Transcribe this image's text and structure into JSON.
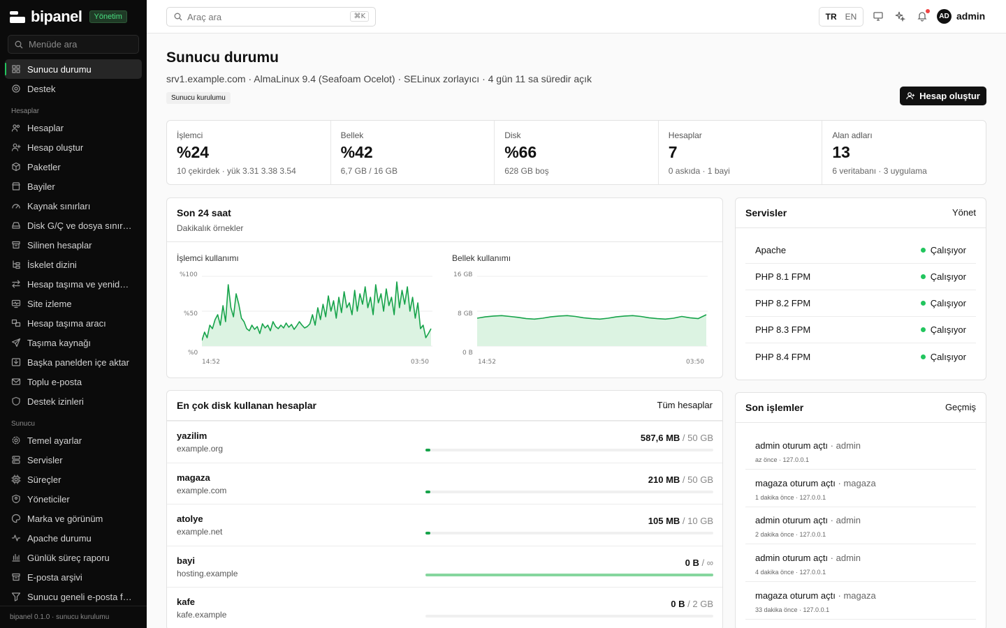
{
  "brand": {
    "name": "bipanel",
    "badge": "Yönetim"
  },
  "sidebar": {
    "search_placeholder": "Menüde ara",
    "top_items": [
      {
        "label": "Sunucu durumu",
        "icon": "dashboard-icon",
        "active": true
      },
      {
        "label": "Destek",
        "icon": "lifebuoy-icon"
      }
    ],
    "section_accounts": "Hesaplar",
    "account_items": [
      {
        "label": "Hesaplar",
        "icon": "users-icon"
      },
      {
        "label": "Hesap oluştur",
        "icon": "user-plus-icon"
      },
      {
        "label": "Paketler",
        "icon": "package-icon"
      },
      {
        "label": "Bayiler",
        "icon": "store-icon"
      },
      {
        "label": "Kaynak sınırları",
        "icon": "gauge-icon"
      },
      {
        "label": "Disk G/Ç ve dosya sınırları",
        "icon": "hard-drive-icon"
      },
      {
        "label": "Silinen hesaplar",
        "icon": "archive-icon"
      },
      {
        "label": "İskelet dizini",
        "icon": "folder-tree-icon"
      },
      {
        "label": "Hesap taşıma ve yeniden adlandırma",
        "icon": "arrows-swap-icon"
      },
      {
        "label": "Site izleme",
        "icon": "monitor-heart-icon"
      },
      {
        "label": "Hesap taşıma aracı",
        "icon": "transfer-icon"
      },
      {
        "label": "Taşıma kaynağı",
        "icon": "send-icon"
      },
      {
        "label": "Başka panelden içe aktar",
        "icon": "import-icon"
      },
      {
        "label": "Toplu e-posta",
        "icon": "mail-icon"
      },
      {
        "label": "Destek izinleri",
        "icon": "shield-icon"
      }
    ],
    "section_server": "Sunucu",
    "server_items": [
      {
        "label": "Temel ayarlar",
        "icon": "gear-icon"
      },
      {
        "label": "Servisler",
        "icon": "server-icon"
      },
      {
        "label": "Süreçler",
        "icon": "cpu-icon"
      },
      {
        "label": "Yöneticiler",
        "icon": "user-shield-icon"
      },
      {
        "label": "Marka ve görünüm",
        "icon": "palette-icon"
      },
      {
        "label": "Apache durumu",
        "icon": "activity-icon"
      },
      {
        "label": "Günlük süreç raporu",
        "icon": "bar-chart-icon"
      },
      {
        "label": "E-posta arşivi",
        "icon": "mail-archive-icon"
      },
      {
        "label": "Sunucu geneli e-posta filtreleri",
        "icon": "filter-icon"
      }
    ],
    "footer": "bipanel 0.1.0 · sunucu kurulumu"
  },
  "topbar": {
    "search_placeholder": "Araç ara",
    "shortcut": "⌘K",
    "lang_active": "TR",
    "lang_other": "EN",
    "avatar_initials": "AD",
    "user": "admin"
  },
  "page": {
    "title": "Sunucu durumu",
    "subtitle": "srv1.example.com · AlmaLinux 9.4 (Seafoam Ocelot) · SELinux zorlayıcı · 4 gün 11 sa süredir açık",
    "crumb": "Sunucu kurulumu",
    "primary_button": "Hesap oluştur"
  },
  "stats": [
    {
      "label": "İşlemci",
      "value": "%24",
      "note": "10 çekirdek · yük 3.31 3.38 3.54"
    },
    {
      "label": "Bellek",
      "value": "%42",
      "note": "6,7 GB / 16 GB"
    },
    {
      "label": "Disk",
      "value": "%66",
      "note": "628 GB boş"
    },
    {
      "label": "Hesaplar",
      "value": "7",
      "note": "0 askıda · 1 bayi"
    },
    {
      "label": "Alan adları",
      "value": "13",
      "note": "6 veritabanı · 3 uygulama"
    }
  ],
  "history": {
    "title": "Son 24 saat",
    "desc": "Dakikalık örnekler",
    "accent": "#16a34a",
    "cpu_label": "İşlemci kullanımı",
    "mem_label": "Bellek kullanımı"
  },
  "chart_data": [
    {
      "type": "area",
      "title": "İşlemci kullanımı",
      "x_start": "14:52",
      "x_end": "03:50",
      "y_ticks": [
        "%100",
        "%50",
        "%0"
      ],
      "ylim": [
        0,
        100
      ],
      "grid": true,
      "series": [
        {
          "values": [
            8,
            20,
            12,
            30,
            25,
            38,
            45,
            30,
            58,
            35,
            88,
            55,
            42,
            75,
            60,
            40,
            35,
            25,
            22,
            30,
            24,
            28,
            18,
            32,
            26,
            30,
            22,
            35,
            28,
            25,
            30,
            26,
            33,
            27,
            31,
            24,
            29,
            35,
            30,
            26,
            28,
            32,
            45,
            30,
            55,
            38,
            60,
            42,
            72,
            50,
            65,
            40,
            70,
            48,
            78,
            55,
            62,
            45,
            80,
            50,
            75,
            60,
            85,
            55,
            70,
            45,
            88,
            62,
            75,
            50,
            82,
            58,
            70,
            45,
            92,
            55,
            80,
            60,
            85,
            50,
            70,
            40,
            62,
            25,
            30,
            12,
            18,
            25
          ]
        }
      ]
    },
    {
      "type": "area",
      "title": "Bellek kullanımı",
      "x_start": "14:52",
      "x_end": "03:50",
      "y_ticks": [
        "16 GB",
        "8 GB",
        "0 B"
      ],
      "ylim": [
        0,
        16
      ],
      "grid": true,
      "series": [
        {
          "values": [
            6.4,
            6.7,
            6.9,
            7.0,
            6.8,
            6.6,
            6.3,
            6.2,
            6.4,
            6.7,
            6.9,
            7.0,
            6.8,
            6.5,
            6.3,
            6.2,
            6.4,
            6.7,
            6.9,
            7.0,
            6.8,
            6.5,
            6.3,
            6.2,
            6.4,
            6.8,
            6.5,
            6.3,
            7.2
          ]
        }
      ]
    }
  ],
  "services": {
    "title": "Servisler",
    "link": "Yönet",
    "items": [
      {
        "name": "Apache",
        "status": "Çalışıyor"
      },
      {
        "name": "PHP 8.1 FPM",
        "status": "Çalışıyor"
      },
      {
        "name": "PHP 8.2 FPM",
        "status": "Çalışıyor"
      },
      {
        "name": "PHP 8.3 FPM",
        "status": "Çalışıyor"
      },
      {
        "name": "PHP 8.4 FPM",
        "status": "Çalışıyor"
      }
    ]
  },
  "accounts": {
    "title": "En çok disk kullanan hesaplar",
    "link": "Tüm hesaplar",
    "items": [
      {
        "name": "yazilim",
        "domain": "example.org",
        "used": "587,6 MB",
        "quota": "50 GB",
        "fraction": 0.012
      },
      {
        "name": "magaza",
        "domain": "example.com",
        "used": "210 MB",
        "quota": "50 GB",
        "fraction": 0.004
      },
      {
        "name": "atolye",
        "domain": "example.net",
        "used": "105 MB",
        "quota": "10 GB",
        "fraction": 0.01
      },
      {
        "name": "bayi",
        "domain": "hosting.example",
        "used": "0 B",
        "quota": "∞",
        "fraction": 1,
        "unlimited": true
      },
      {
        "name": "kafe",
        "domain": "kafe.example",
        "used": "0 B",
        "quota": "2 GB",
        "fraction": 0
      }
    ]
  },
  "activity": {
    "title": "Son işlemler",
    "link": "Geçmiş",
    "items": [
      {
        "action": "admin oturum açtı",
        "who": "admin",
        "meta": "az önce · 127.0.0.1"
      },
      {
        "action": "magaza oturum açtı",
        "who": "magaza",
        "meta": "1 dakika önce · 127.0.0.1"
      },
      {
        "action": "admin oturum açtı",
        "who": "admin",
        "meta": "2 dakika önce · 127.0.0.1"
      },
      {
        "action": "admin oturum açtı",
        "who": "admin",
        "meta": "4 dakika önce · 127.0.0.1"
      },
      {
        "action": "magaza oturum açtı",
        "who": "magaza",
        "meta": "33 dakika önce · 127.0.0.1"
      }
    ]
  }
}
